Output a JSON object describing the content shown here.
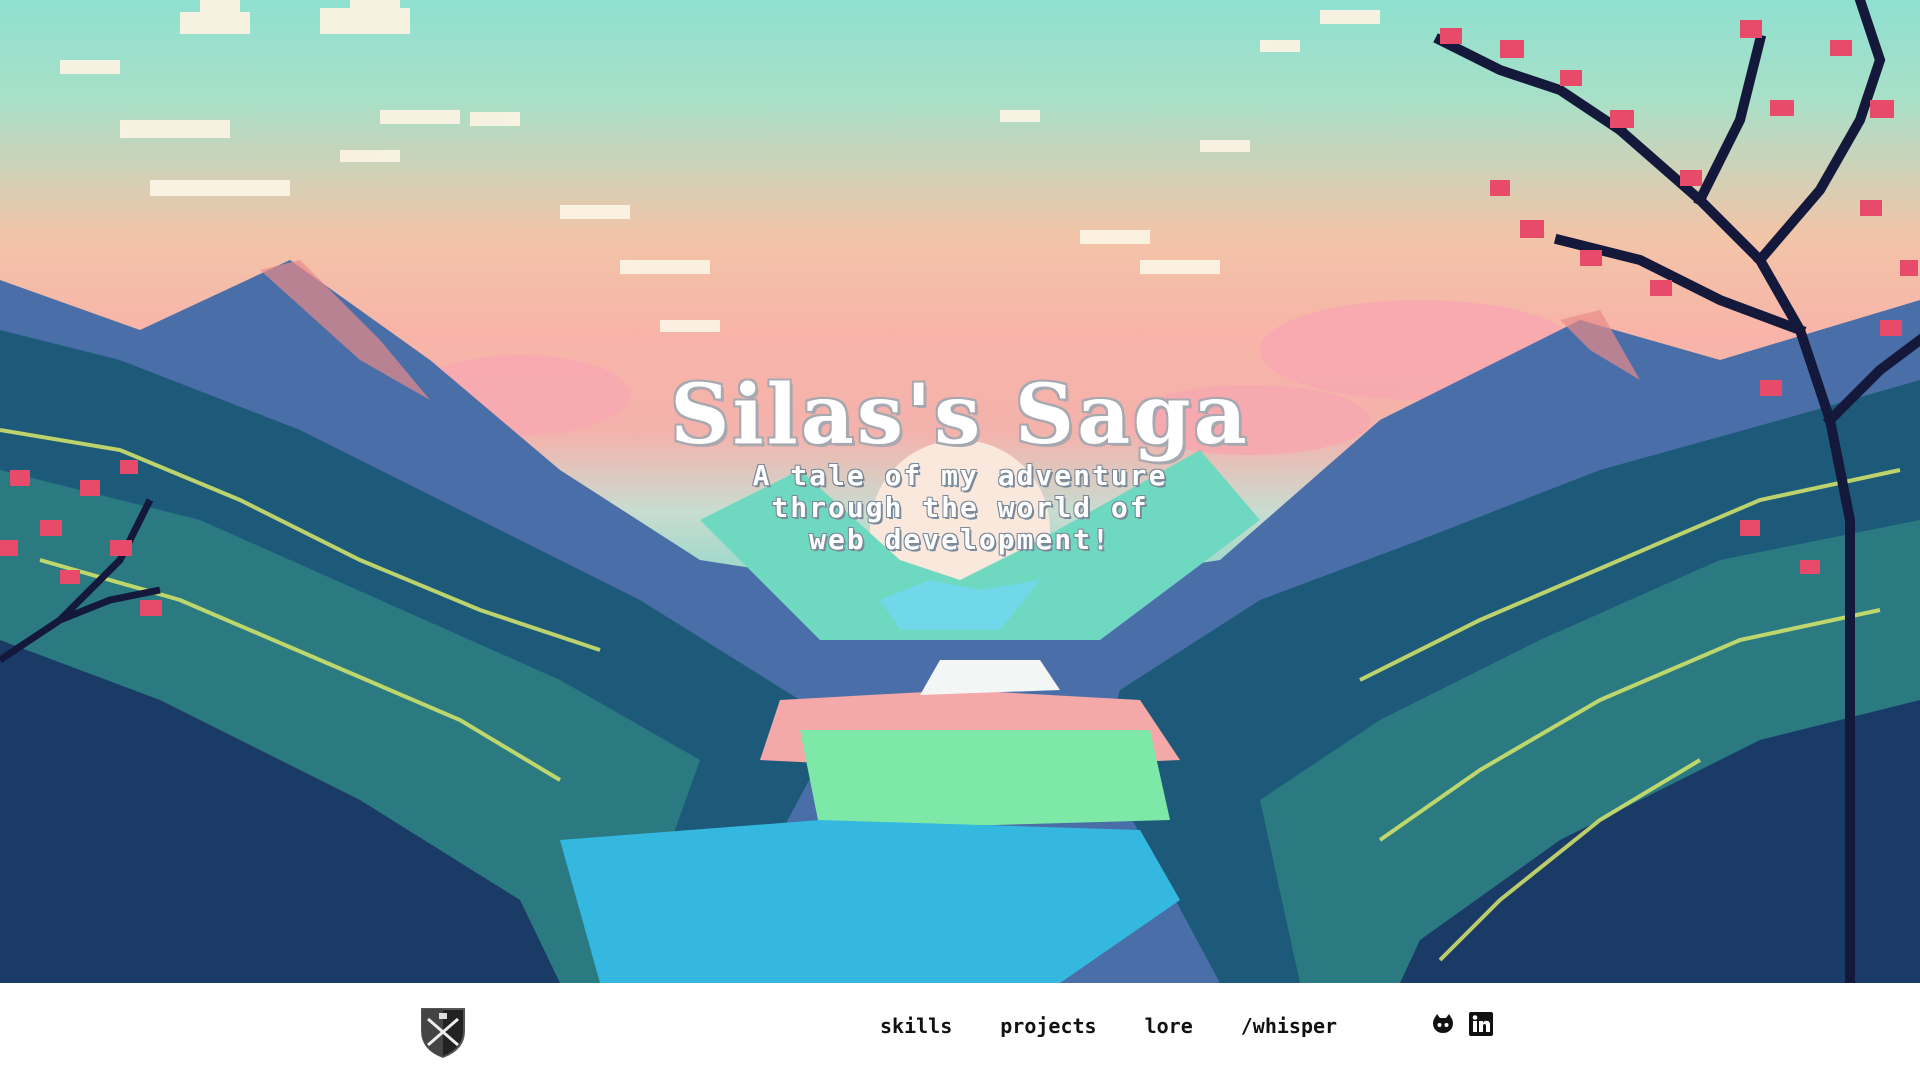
{
  "hero": {
    "title": "Silas's Saga",
    "subtitle_lines": [
      "A tale of my adventure",
      "through the world of",
      "web development!"
    ]
  },
  "nav": {
    "links": [
      {
        "label": "skills"
      },
      {
        "label": "projects"
      },
      {
        "label": "lore"
      },
      {
        "label": "/whisper"
      }
    ],
    "icons": [
      "shield-logo-icon",
      "github-icon",
      "linkedin-icon"
    ]
  },
  "colors": {
    "sky_top": "#8fe0d0",
    "sky_mid": "#f8b4a8",
    "mountain_dark": "#1e3a6a",
    "lake": "#34b8e0",
    "blossom": "#e84a6a"
  }
}
